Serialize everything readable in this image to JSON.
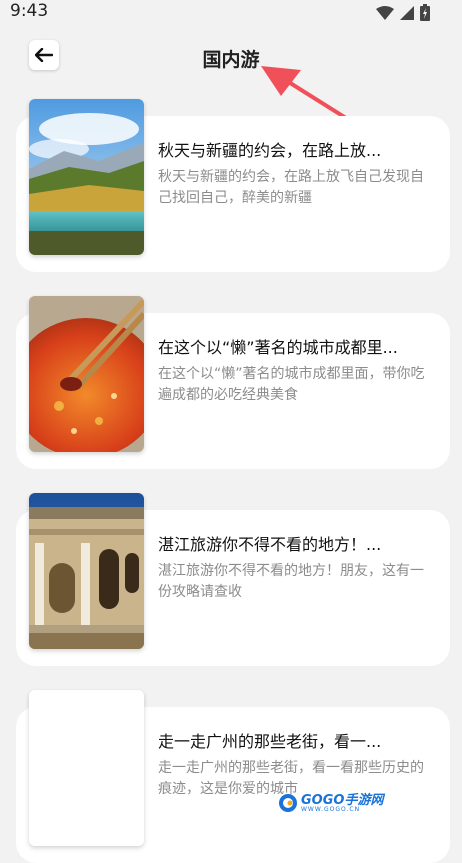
{
  "status_bar": {
    "time": "9:43"
  },
  "header": {
    "title": "国内游"
  },
  "articles": [
    {
      "title": "秋天与新疆的约会，在路上放...",
      "description": "秋天与新疆的约会，在路上放飞自己发现自己找回自己，醉美的新疆"
    },
    {
      "title": "在这个以“懒”著名的城市成都里...",
      "description": "在这个以“懒”著名的城市成都里面，带你吃遍成都的必吃经典美食"
    },
    {
      "title": "湛江旅游你不得不看的地方！...",
      "description": "湛江旅游你不得不看的地方！朋友，这有一份攻略请查收"
    },
    {
      "title": "走一走广州的那些老街，看一...",
      "description": "走一走广州的那些老街，看一看那些历史的痕迹，这是你爱的城市"
    }
  ],
  "watermark": {
    "brand": "GOGO手游网",
    "url": "WWW.GOGO.CN"
  },
  "icons": {
    "back": "arrow-left-icon",
    "wifi": "wifi-icon",
    "signal": "signal-icon",
    "battery": "battery-icon"
  },
  "colors": {
    "background": "#f2f2f2",
    "card": "#ffffff",
    "annotation_arrow": "#f0505a",
    "description_text": "#8c8c8c"
  }
}
